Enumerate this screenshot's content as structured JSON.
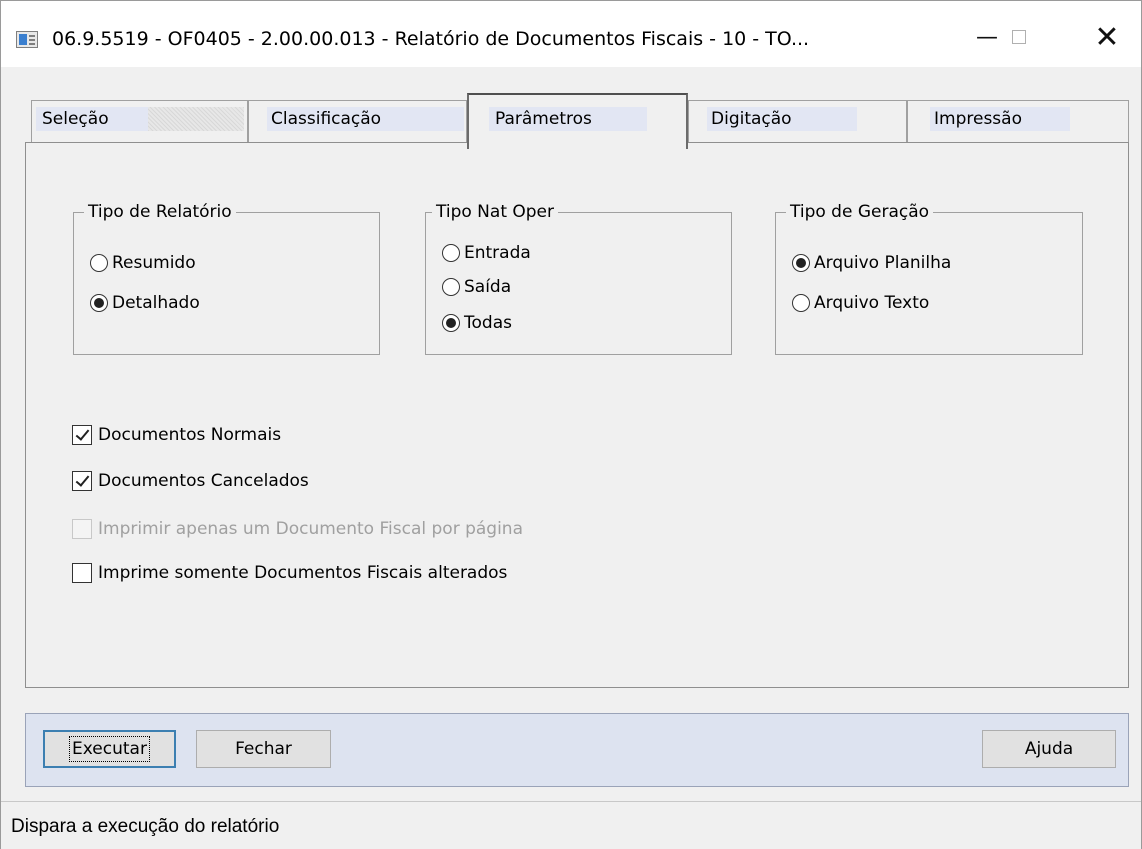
{
  "window": {
    "title": "06.9.5519 - OF0405 - 2.00.00.013 - Relatório de Documentos Fiscais - 10 - TO...",
    "minimize_glyph": "—",
    "close_glyph": "✕"
  },
  "tabs": [
    {
      "label": "Seleção",
      "active": false
    },
    {
      "label": "Classificação",
      "active": false
    },
    {
      "label": "Parâmetros",
      "active": true
    },
    {
      "label": "Digitação",
      "active": false
    },
    {
      "label": "Impressão",
      "active": false
    }
  ],
  "groups": {
    "tipo_relatorio": {
      "title": "Tipo de Relatório",
      "options": [
        {
          "label": "Resumido",
          "selected": false
        },
        {
          "label": "Detalhado",
          "selected": true
        }
      ]
    },
    "tipo_nat_oper": {
      "title": "Tipo Nat Oper",
      "options": [
        {
          "label": "Entrada",
          "selected": false
        },
        {
          "label": "Saída",
          "selected": false
        },
        {
          "label": "Todas",
          "selected": true
        }
      ]
    },
    "tipo_geracao": {
      "title": "Tipo de Geração",
      "options": [
        {
          "label": "Arquivo Planilha",
          "selected": true
        },
        {
          "label": "Arquivo Texto",
          "selected": false
        }
      ]
    }
  },
  "checkboxes": [
    {
      "label": "Documentos Normais",
      "checked": true,
      "enabled": true
    },
    {
      "label": "Documentos Cancelados",
      "checked": true,
      "enabled": true
    },
    {
      "label": "Imprimir apenas um Documento Fiscal por página",
      "checked": false,
      "enabled": false
    },
    {
      "label": "Imprime somente Documentos Fiscais alterados",
      "checked": false,
      "enabled": true
    }
  ],
  "buttons": {
    "execute": "Executar",
    "close": "Fechar",
    "help": "Ajuda"
  },
  "status_bar": {
    "text": "Dispara a execução do relatório"
  }
}
